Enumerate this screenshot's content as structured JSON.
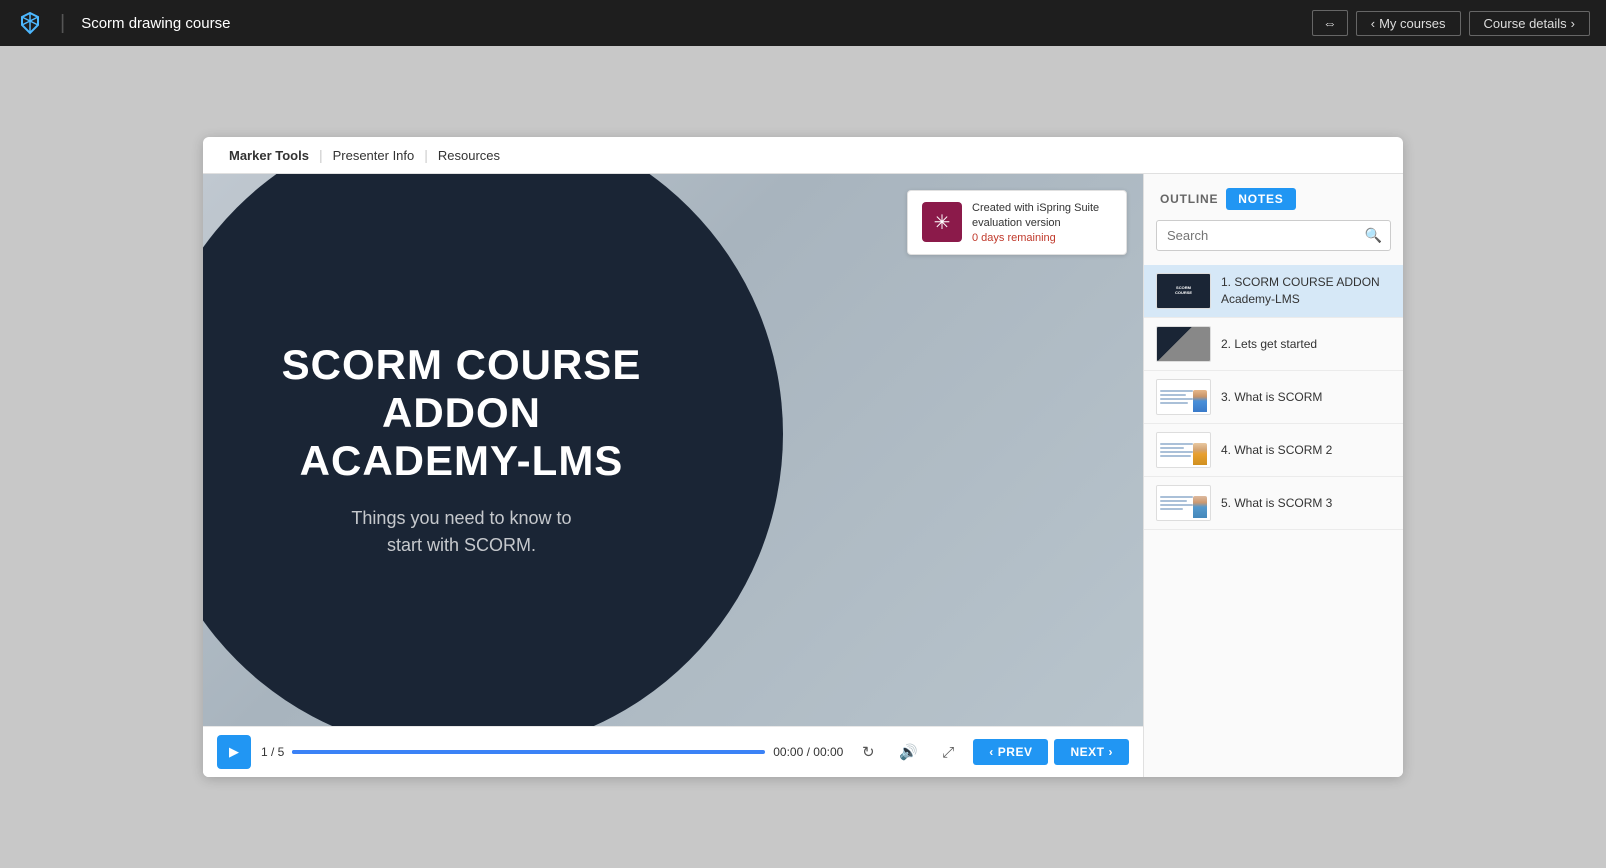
{
  "nav": {
    "title": "Scorm drawing course",
    "courses_btn": "My courses",
    "details_btn": "Course details"
  },
  "toolbar": {
    "item1": "Marker Tools",
    "item2": "Presenter Info",
    "item3": "Resources"
  },
  "slide": {
    "title": "SCORM COURSE\nADDON\nAcademy-LMS",
    "subtitle": "Things you need to know to\nstart with SCORM.",
    "watermark_title": "Created with iSpring Suite evaluation version",
    "watermark_remaining": "0 days remaining"
  },
  "controls": {
    "slide_info": "1 / 5",
    "time": "00:00 / 00:00",
    "prev_label": "PREV",
    "next_label": "NEXT"
  },
  "sidebar": {
    "outline_tab": "OUTLINE",
    "notes_tab": "NOTES",
    "search_placeholder": "Search",
    "outline_items": [
      {
        "id": 1,
        "label": "1. SCORM COURSE ADDON Academy-LMS",
        "type": "dark"
      },
      {
        "id": 2,
        "label": "2. Lets get started",
        "type": "slide2"
      },
      {
        "id": 3,
        "label": "3. What is SCORM",
        "type": "lines"
      },
      {
        "id": 4,
        "label": "4. What is SCORM 2",
        "type": "lines"
      },
      {
        "id": 5,
        "label": "5. What is SCORM 3",
        "type": "lines"
      }
    ]
  }
}
